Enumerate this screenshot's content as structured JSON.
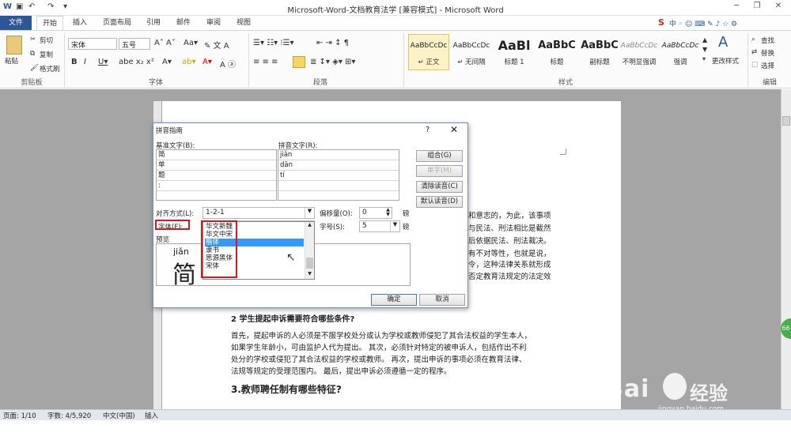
{
  "window": {
    "title": "Microsoft-Word-文档教育法学 [兼容模式] - Microsoft Word"
  },
  "tabs": [
    "文件",
    "开始",
    "插入",
    "页面布局",
    "引用",
    "邮件",
    "审阅",
    "视图"
  ],
  "ribbon": {
    "clipboard": {
      "paste": "粘贴",
      "cut": "剪切",
      "copy": "复制",
      "painter": "格式刷",
      "label": "剪贴板"
    },
    "font": {
      "font_name": "宋体",
      "font_size": "五号",
      "label": "字体"
    },
    "paragraph": {
      "label": "段落"
    },
    "styles": {
      "items": [
        {
          "preview": "AaBbCcDc",
          "name": "↵ 正文"
        },
        {
          "preview": "AaBbCcDc",
          "name": "↵ 无间隔"
        },
        {
          "preview": "AaBl",
          "name": "标题 1"
        },
        {
          "preview": "AaBbC",
          "name": "标题"
        },
        {
          "preview": "AaBbC",
          "name": "副标题"
        },
        {
          "preview": "AaBbCcDc",
          "name": "不明显强调"
        },
        {
          "preview": "AaBbCcDc",
          "name": "强调"
        }
      ],
      "change": "更改样式",
      "label": "样式"
    },
    "editing": {
      "find": "查找",
      "replace": "替换",
      "select": "选择",
      "label": "编辑"
    }
  },
  "document": {
    "right_lines": [
      "和意志的，为此，该事项",
      "与民法、刑法相比是截然",
      "后依据民法、刑法裁决。",
      "有不对等性，也就是说，",
      "令，这种法律关系就形成",
      "否定教育法规定的法定效"
    ],
    "heading2": "2 学生提起申诉需要符合哪些条件?",
    "para2": [
      "首先，提起申诉的人必须是不服学校处分或认为学校或教师侵犯了其合法权益的学生本人，",
      "如果学生年龄小，可由监护人代为提出。 其次，必须针对特定的被申诉人，包括作出不利",
      "处分的学校或侵犯了其合法权益的学校或教师。 再次，提出申诉的事项必须在教育法律、",
      "法规等规定的受理范围内。 最后，提出申诉必须遵循一定的程序。"
    ],
    "heading3": "3.教师聘任制有哪些特征?"
  },
  "dialog": {
    "title": "拼音指南",
    "help": "?",
    "base_label": "基准文字(B):",
    "ruby_label": "拼音文字(R):",
    "base_chars": [
      "简",
      "单",
      "题",
      ":",
      ""
    ],
    "ruby_chars": [
      "jiǎn",
      "dān",
      "tí",
      "",
      ""
    ],
    "buttons": {
      "group": "组合(G)",
      "single": "单字(M)",
      "clear": "清除读音(C)",
      "default": "默认读音(D)",
      "ok": "确定",
      "cancel": "取消"
    },
    "align_label": "对齐方式(L):",
    "align_value": "1-2-1",
    "offset_label": "偏移量(O):",
    "offset_value": "0",
    "offset_unit": "磅",
    "font_label": "字体(F):",
    "font_value": "宋体",
    "size_label": "字号(S):",
    "size_value": "5",
    "size_unit": "磅",
    "preview_label": "预览",
    "preview_ruby": "jiǎn",
    "preview_char": "简",
    "font_options": [
      "华文新魏",
      "华文中宋",
      "楷体",
      "隶书",
      "思源黑体",
      "宋体"
    ],
    "selected_font": "楷体"
  },
  "status": {
    "page": "页面: 1/10",
    "words": "字数: 4/5,920",
    "lang": "中文(中国)",
    "mode": "插入"
  },
  "watermark": {
    "brand": "Bai",
    "brand2": "经验",
    "url": "jingyan.baidu.com"
  }
}
